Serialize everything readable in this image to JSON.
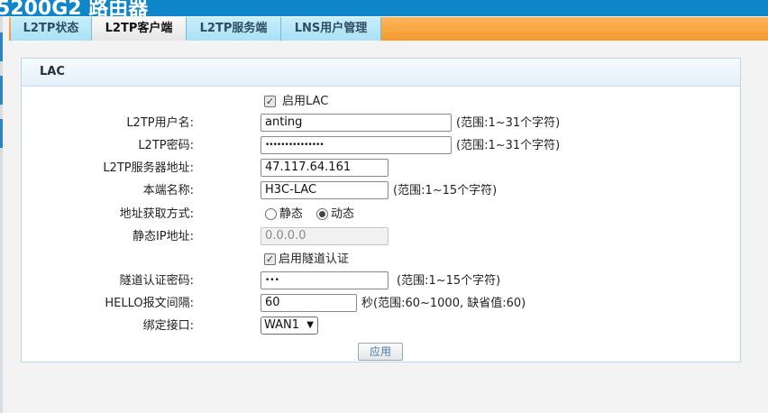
{
  "window": {
    "title": "5200G2 路由器"
  },
  "tabs": [
    {
      "label": "L2TP状态"
    },
    {
      "label": "L2TP客户端"
    },
    {
      "label": "L2TP服务端"
    },
    {
      "label": "LNS用户管理"
    }
  ],
  "active_tab": "L2TP客户端",
  "panel": {
    "title": "LAC"
  },
  "form": {
    "enable_lac": {
      "label": "启用LAC",
      "checked": true
    },
    "username": {
      "label": "L2TP用户名:",
      "value": "anting",
      "hint": "(范围:1~31个字符)"
    },
    "password": {
      "label": "L2TP密码:",
      "value": "•••••••••••••••",
      "hint": "(范围:1~31个字符)"
    },
    "server": {
      "label": "L2TP服务器地址:",
      "value": "47.117.64.161"
    },
    "local_name": {
      "label": "本端名称:",
      "value": "H3C-LAC",
      "hint": "(范围:1~15个字符)"
    },
    "addr_mode": {
      "label": "地址获取方式:",
      "static_label": "静态",
      "dynamic_label": "动态",
      "selected": "动态"
    },
    "static_ip": {
      "label": "静态IP地址:",
      "value": "0.0.0.0"
    },
    "tunnel_auth": {
      "label": "启用隧道认证",
      "checked": true
    },
    "tunnel_password": {
      "label": "隧道认证密码:",
      "value": "•••",
      "hint": "(范围:1~15个字符)"
    },
    "hello": {
      "label": "HELLO报文间隔:",
      "value": "60",
      "hint": "秒(范围:60~1000, 缺省值:60)"
    },
    "bind_iface": {
      "label": "绑定接口:",
      "value": "WAN1",
      "options": [
        "WAN1"
      ]
    }
  },
  "apply_label": "应用",
  "colors": {
    "header": "#0e86c9",
    "tab_bar": "#f39a2c",
    "tab": "#b5e5f8",
    "panel_border": "#bcd6ea"
  },
  "icons": {
    "checkbox": "check-icon",
    "dropdown": "chevron-down-icon"
  }
}
